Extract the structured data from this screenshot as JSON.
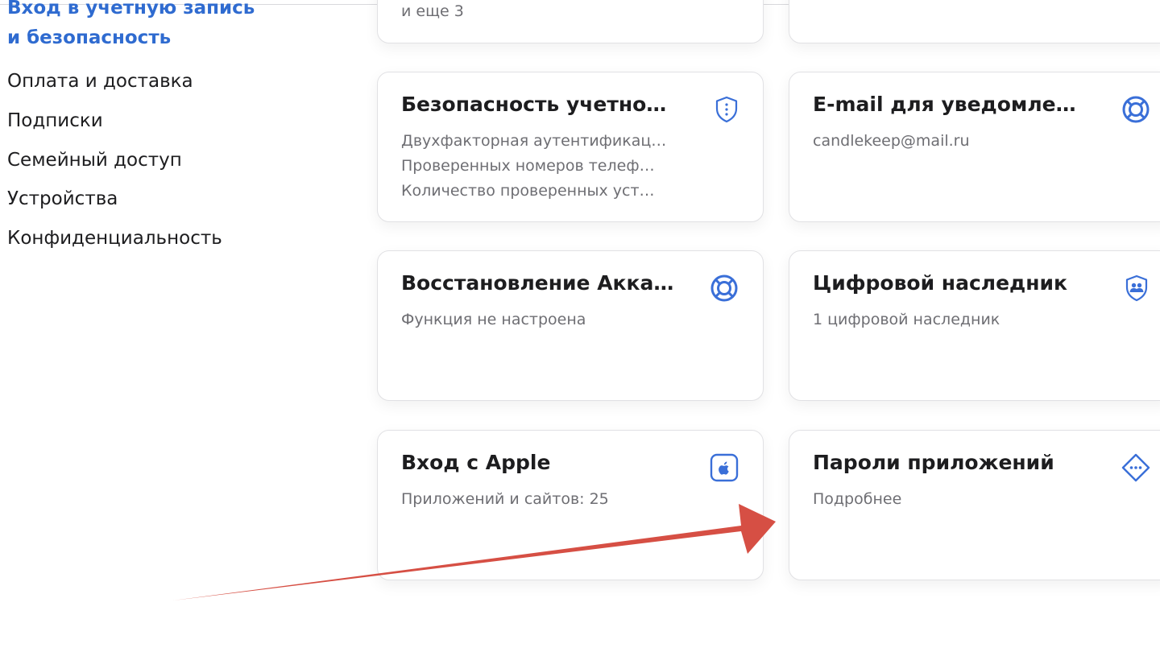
{
  "sidebar": {
    "active_line1": "Вход в учетную запись",
    "active_line2": "и безопасность",
    "items": [
      {
        "label": "Оплата и доставка"
      },
      {
        "label": "Подписки"
      },
      {
        "label": "Семейный доступ"
      },
      {
        "label": "Устройства"
      },
      {
        "label": "Конфиденциальность"
      }
    ]
  },
  "cards": {
    "top_left": {
      "subtitle": "и еще 3"
    },
    "security": {
      "title": "Безопасность учетно…",
      "lines": [
        "Двухфакторная аутентификац…",
        "Проверенных номеров телеф…",
        "Количество проверенных уст…"
      ],
      "icon": "shield-icon"
    },
    "email": {
      "title": "E-mail для уведомлен…",
      "subtitle": "candlekeep@mail.ru",
      "icon": "lifebuoy-icon"
    },
    "recovery": {
      "title": "Восстановление Акка…",
      "subtitle": "Функция не настроена",
      "icon": "lifebuoy-icon"
    },
    "legacy": {
      "title": "Цифровой наследник",
      "subtitle": "1 цифровой наследник",
      "icon": "shield-people-icon"
    },
    "sign_in_apple": {
      "title": "Вход с Apple",
      "subtitle": "Приложений и сайтов: 25",
      "icon": "apple-icon"
    },
    "app_passwords": {
      "title": "Пароли приложений",
      "subtitle": "Подробнее",
      "icon": "dots-diamond-icon"
    }
  },
  "colors": {
    "accent": "#2f6bd0",
    "icon": "#3a6fd8",
    "arrow": "#d64f44"
  }
}
